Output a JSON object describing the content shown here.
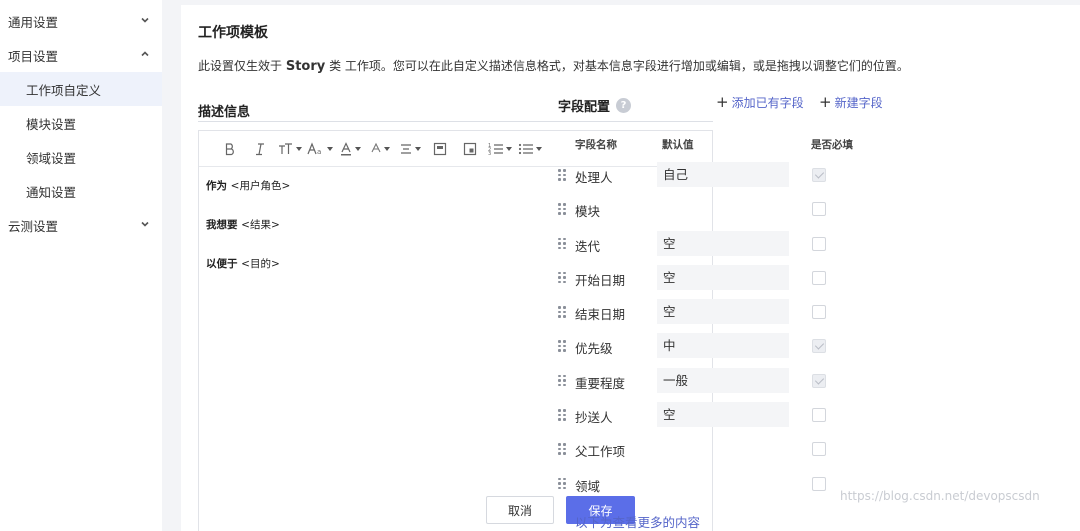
{
  "sidebar": {
    "items": [
      {
        "label": "通用设置"
      },
      {
        "label": "项目设置"
      },
      {
        "label": "工作项自定义"
      },
      {
        "label": "模块设置"
      },
      {
        "label": "领域设置"
      },
      {
        "label": "通知设置"
      },
      {
        "label": "云测设置"
      }
    ]
  },
  "page": {
    "title": "工作项模板",
    "desc_prefix": "此设置仅生效于",
    "desc_type": "Story",
    "desc_suffix": "类 工作项。您可以在此自定义描述信息格式，对基本信息字段进行增加或编辑，或是拖拽以调整它们的位置。"
  },
  "description": {
    "title": "描述信息",
    "lines": [
      {
        "bold": "作为",
        "placeholder": "<用户角色>"
      },
      {
        "bold": "我想要",
        "placeholder": "<结果>"
      },
      {
        "bold": "以便于",
        "placeholder": "<目的>"
      }
    ],
    "cancel_label": "取消",
    "save_label": "保存"
  },
  "field_config": {
    "title": "字段配置",
    "help": "?",
    "add_existing_label": "添加已有字段",
    "new_field_label": "新建字段",
    "col_name": "字段名称",
    "col_default": "默认值",
    "col_required": "是否必填",
    "rows": [
      {
        "name": "处理人",
        "default": "自己",
        "required": true
      },
      {
        "name": "模块",
        "default": "",
        "required": false
      },
      {
        "name": "迭代",
        "default": "空",
        "required": false
      },
      {
        "name": "开始日期",
        "default": "空",
        "required": false
      },
      {
        "name": "结束日期",
        "default": "空",
        "required": false
      },
      {
        "name": "优先级",
        "default": "中",
        "required": true
      },
      {
        "name": "重要程度",
        "default": "一般",
        "required": true
      },
      {
        "name": "抄送人",
        "default": "空",
        "required": false
      },
      {
        "name": "父工作项",
        "default": "",
        "required": false
      },
      {
        "name": "领域",
        "default": "",
        "required": false
      }
    ],
    "more_label": "以下为查看更多的内容"
  },
  "watermark": "https://blog.csdn.net/devopscsdn",
  "colors": {
    "accent": "#5b6ee8",
    "link": "#5565c9",
    "active_bg": "#eef2fb"
  }
}
